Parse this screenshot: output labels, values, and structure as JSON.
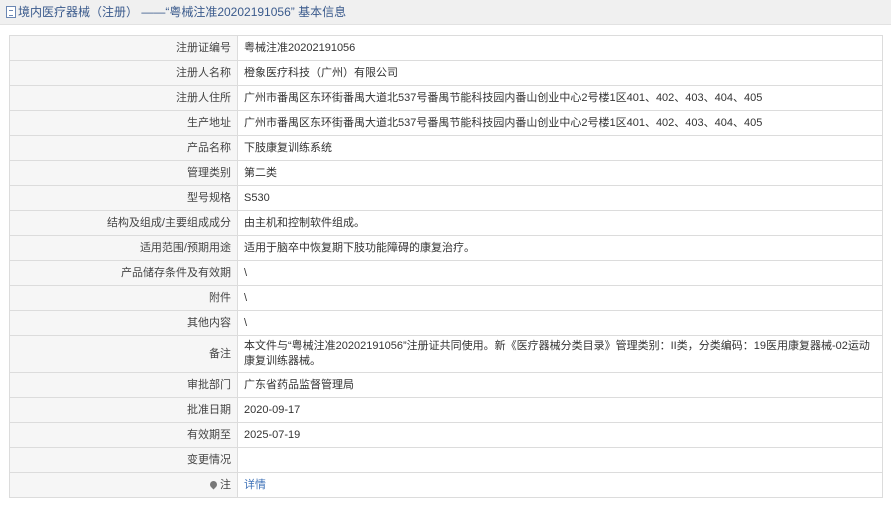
{
  "header": {
    "title": "境内医疗器械（注册） ——“粤械注准20202191056” 基本信息"
  },
  "rows": [
    {
      "label": "注册证编号",
      "value": "粤械注准20202191056"
    },
    {
      "label": "注册人名称",
      "value": "橙象医疗科技（广州）有限公司"
    },
    {
      "label": "注册人住所",
      "value": "广州市番禺区东环街番禺大道北537号番禺节能科技园内番山创业中心2号楼1区401、402、403、404、405"
    },
    {
      "label": "生产地址",
      "value": "广州市番禺区东环街番禺大道北537号番禺节能科技园内番山创业中心2号楼1区401、402、403、404、405"
    },
    {
      "label": "产品名称",
      "value": "下肢康复训练系统"
    },
    {
      "label": "管理类别",
      "value": "第二类"
    },
    {
      "label": "型号规格",
      "value": "S530"
    },
    {
      "label": "结构及组成/主要组成成分",
      "value": "由主机和控制软件组成。"
    },
    {
      "label": "适用范围/预期用途",
      "value": "适用于脑卒中恢复期下肢功能障碍的康复治疗。"
    },
    {
      "label": "产品储存条件及有效期",
      "value": "\\"
    },
    {
      "label": "附件",
      "value": "\\"
    },
    {
      "label": "其他内容",
      "value": "\\"
    },
    {
      "label": "备注",
      "value": "本文件与“粤械注准20202191056”注册证共同使用。新《医疗器械分类目录》管理类别：II类，分类编码：19医用康复器械-02运动康复训练器械。"
    },
    {
      "label": "审批部门",
      "value": "广东省药品监督管理局"
    },
    {
      "label": "批准日期",
      "value": "2020-09-17"
    },
    {
      "label": "有效期至",
      "value": "2025-07-19"
    },
    {
      "label": "变更情况",
      "value": ""
    }
  ],
  "note": {
    "label": "注",
    "link_text": "详情",
    "icon": "map-pin-icon"
  },
  "colors": {
    "link": "#3b6fb6",
    "title": "#3a5a8c",
    "label_bg": "#f6f6f6",
    "border": "#dcdcdc"
  }
}
